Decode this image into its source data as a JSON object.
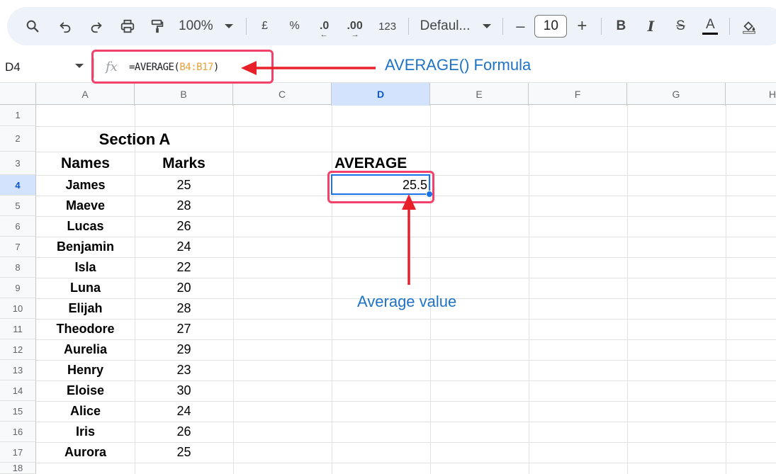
{
  "toolbar": {
    "zoom": "100%",
    "currency": "£",
    "percent": "%",
    "decrease_decimal": ".0",
    "increase_decimal": ".00",
    "number_format": "123",
    "font_name": "Defaul...",
    "font_size": "10",
    "minus": "–",
    "plus": "+",
    "bold": "B",
    "italic": "I",
    "strike": "S",
    "text_color": "A"
  },
  "formula_bar": {
    "cell_ref": "D4",
    "fx": "fx",
    "formula_prefix": "=AVERAGE(",
    "formula_range": "B4:B17",
    "formula_suffix": ")"
  },
  "columns": [
    "A",
    "B",
    "C",
    "D",
    "E",
    "F",
    "G",
    "H"
  ],
  "rows": [
    "1",
    "2",
    "3",
    "4",
    "5",
    "6",
    "7",
    "8",
    "9",
    "10",
    "11",
    "12",
    "13",
    "14",
    "15",
    "16",
    "17",
    "18"
  ],
  "sheet": {
    "section_title": "Section A",
    "header_names": "Names",
    "header_marks": "Marks",
    "average_header": "AVERAGE",
    "average_value": "25.5",
    "data": [
      {
        "name": "James",
        "mark": "25"
      },
      {
        "name": "Maeve",
        "mark": "28"
      },
      {
        "name": "Lucas",
        "mark": "26"
      },
      {
        "name": "Benjamin",
        "mark": "24"
      },
      {
        "name": "Isla",
        "mark": "22"
      },
      {
        "name": "Luna",
        "mark": "20"
      },
      {
        "name": "Elijah",
        "mark": "28"
      },
      {
        "name": "Theodore",
        "mark": "27"
      },
      {
        "name": "Aurelia",
        "mark": "29"
      },
      {
        "name": "Henry",
        "mark": "23"
      },
      {
        "name": "Eloise",
        "mark": "30"
      },
      {
        "name": "Alice",
        "mark": "24"
      },
      {
        "name": "Iris",
        "mark": "26"
      },
      {
        "name": "Aurora",
        "mark": "25"
      }
    ]
  },
  "annotations": {
    "formula_label": "AVERAGE() Formula",
    "value_label": "Average value",
    "highlight_color": "#f2426b",
    "arrow_color": "#e8202a",
    "label_color": "#1f73c6"
  }
}
